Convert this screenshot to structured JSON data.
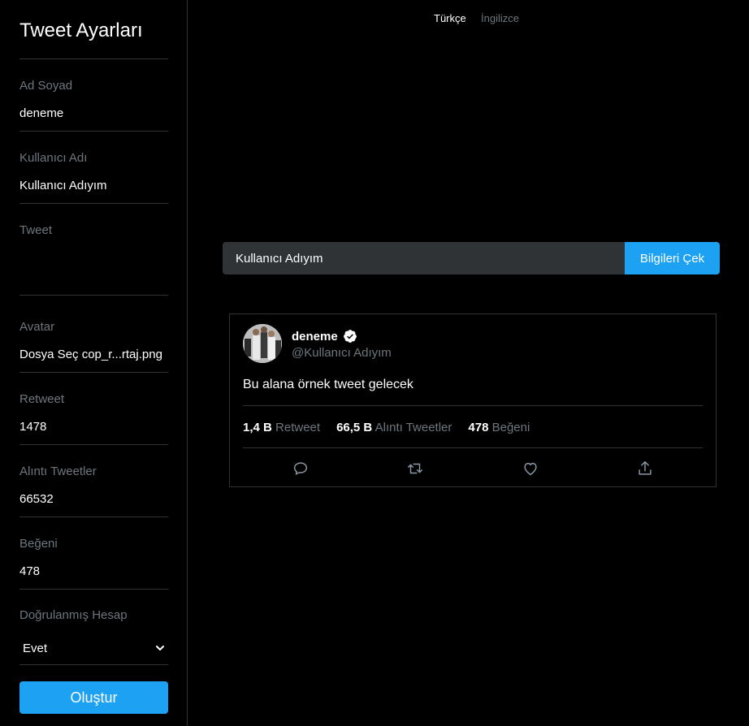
{
  "sidebar": {
    "title": "Tweet Ayarları",
    "fields": {
      "name": {
        "label": "Ad Soyad",
        "value": "deneme"
      },
      "username": {
        "label": "Kullanıcı Adı",
        "value": "Kullanıcı Adıyım"
      },
      "tweet": {
        "label": "Tweet",
        "value": ""
      },
      "avatar": {
        "label": "Avatar",
        "value": "Dosya Seç cop_r...rtaj.png"
      },
      "retweet": {
        "label": "Retweet",
        "value": "1478"
      },
      "quotes": {
        "label": "Alıntı Tweetler",
        "value": "66532"
      },
      "likes": {
        "label": "Beğeni",
        "value": "478"
      },
      "verified": {
        "label": "Doğrulanmış Hesap",
        "value": "Evet"
      }
    },
    "create_label": "Oluştur"
  },
  "language": {
    "active": "Türkçe",
    "inactive": "İngilizce"
  },
  "fetch": {
    "input_value": "Kullanıcı Adıyım",
    "button_label": "Bilgileri Çek"
  },
  "tweet": {
    "name": "deneme",
    "handle": "@Kullanıcı Adıyım",
    "text": "Bu alana örnek tweet gelecek",
    "stats": {
      "retweet_count": "1,4 B",
      "retweet_label": "Retweet",
      "quote_count": "66,5 B",
      "quote_label": "Alıntı Tweetler",
      "like_count": "478",
      "like_label": "Beğeni"
    }
  },
  "colors": {
    "accent": "#1da1f2",
    "border": "#2f3336",
    "muted": "#6e767d",
    "background": "#000000"
  }
}
